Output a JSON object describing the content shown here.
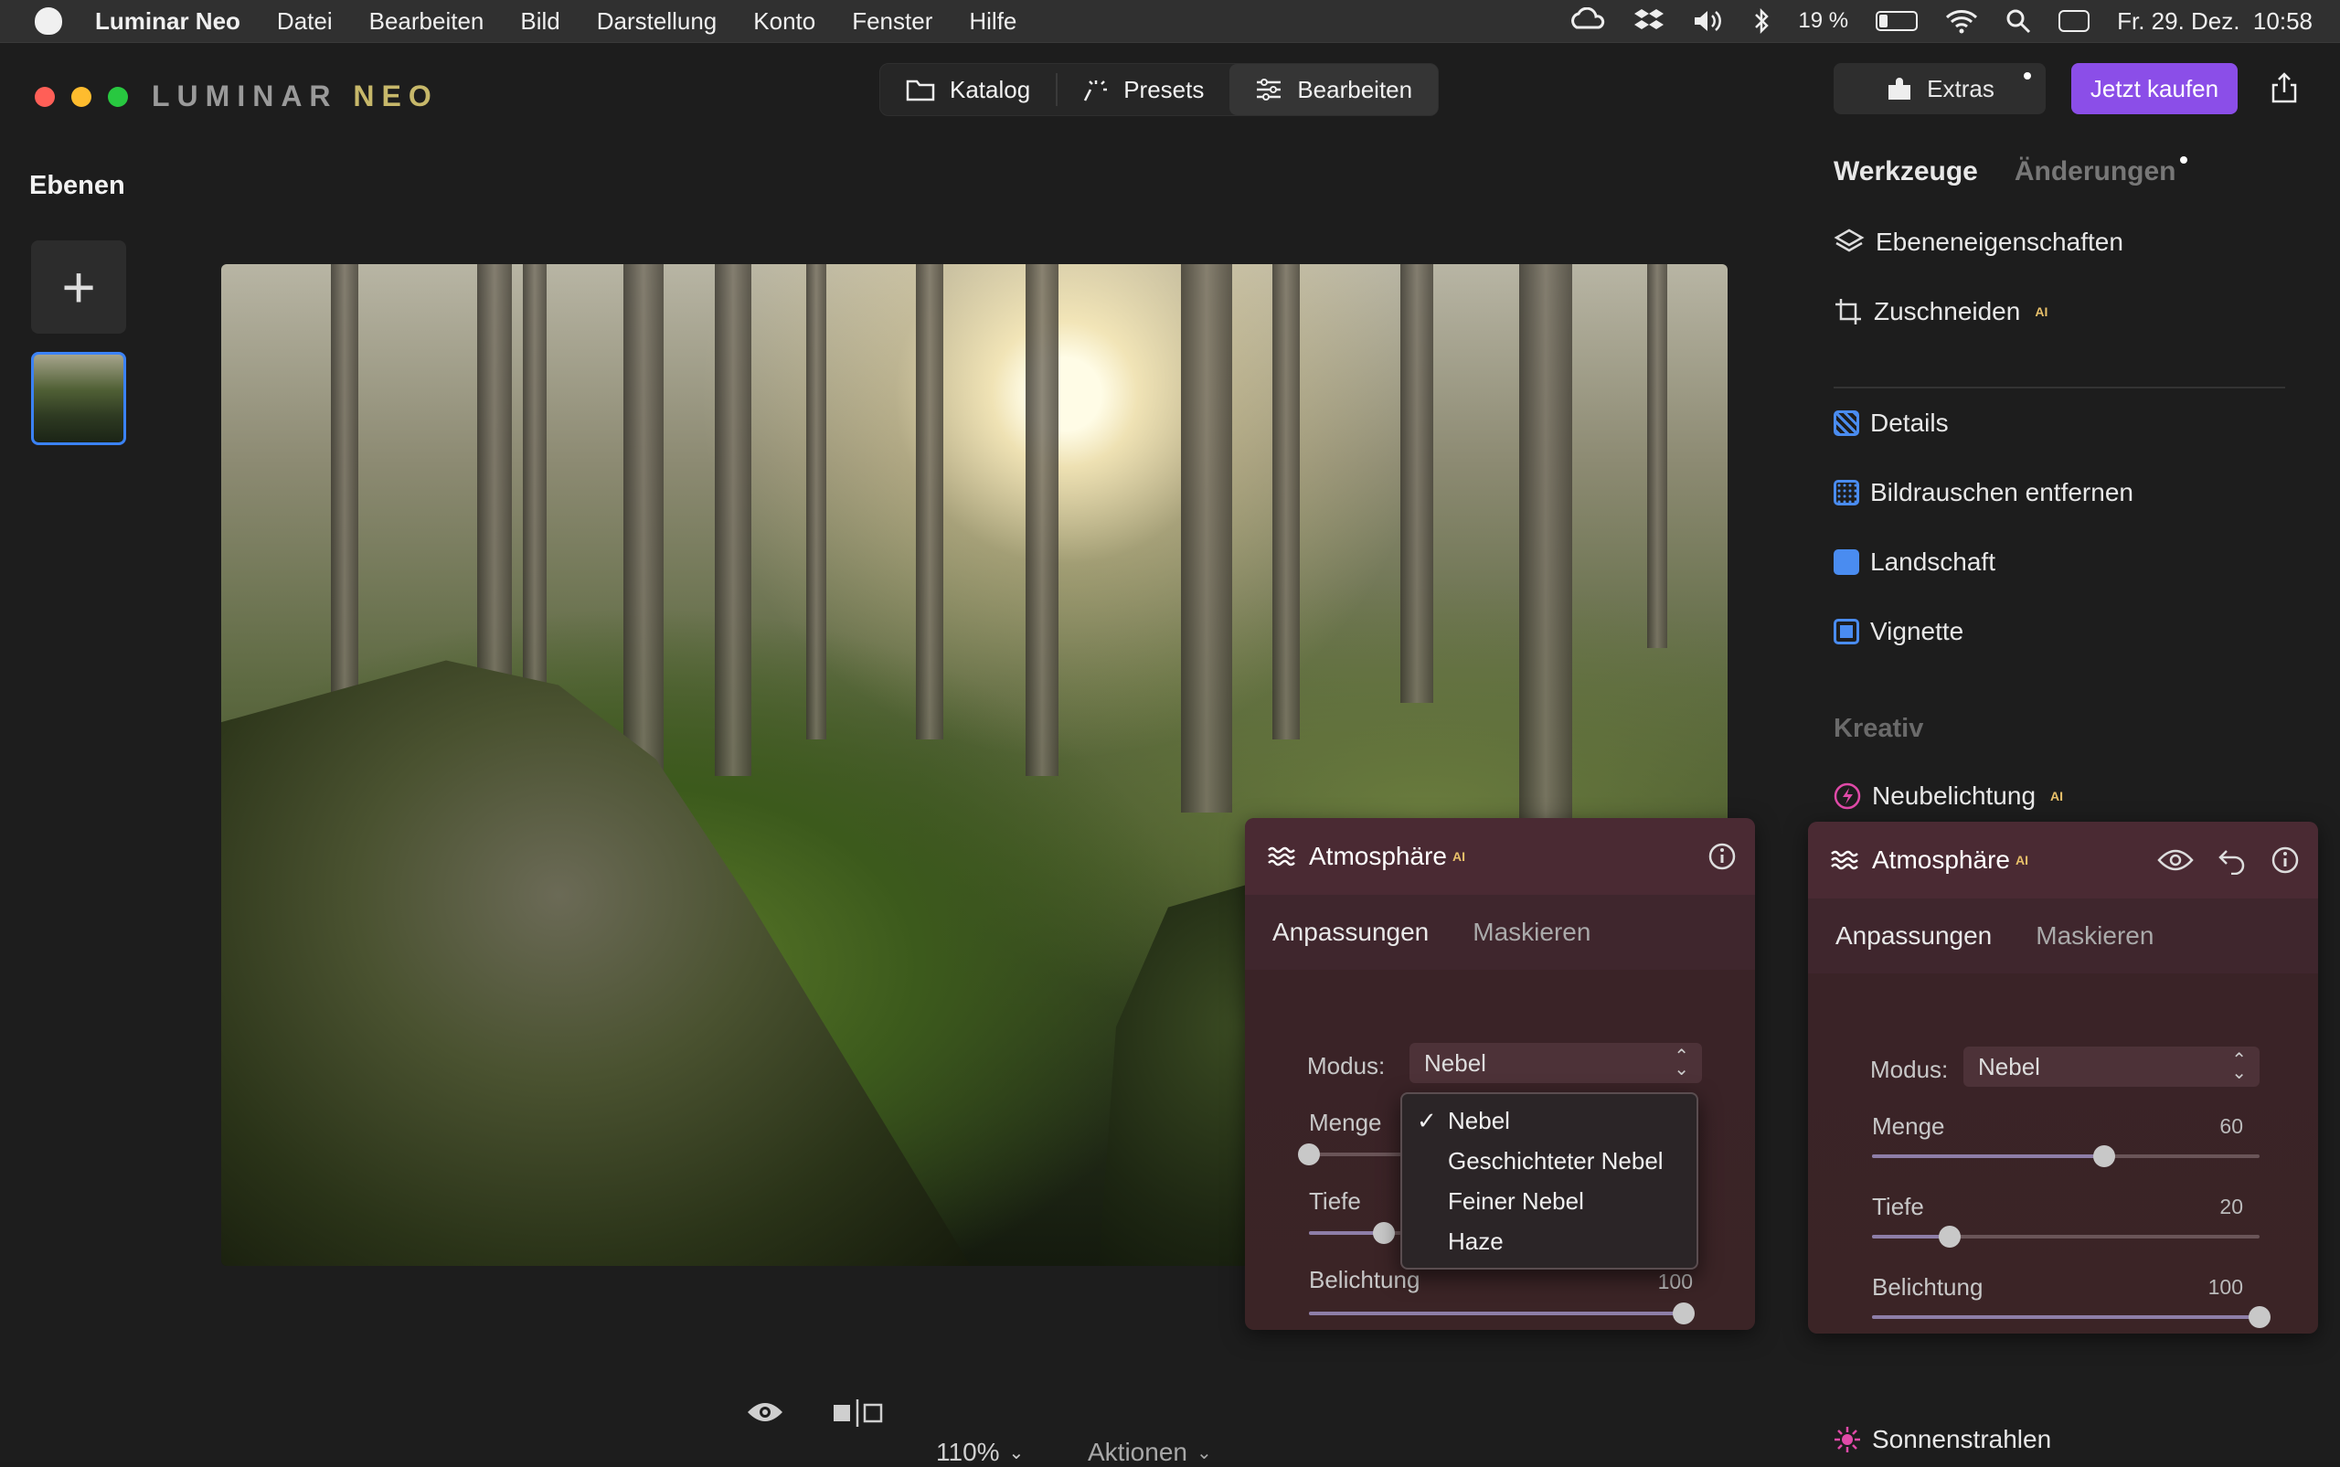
{
  "menubar": {
    "app": "Luminar Neo",
    "items": [
      "Datei",
      "Bearbeiten",
      "Bild",
      "Darstellung",
      "Konto",
      "Fenster",
      "Hilfe"
    ],
    "battery": "19 %",
    "datetime": "Fr. 29. Dez.  10:58"
  },
  "logo": {
    "part1": "LUMINAR ",
    "part2": "NEO"
  },
  "nav": {
    "katalog": "Katalog",
    "presets": "Presets",
    "bearbeiten": "Bearbeiten"
  },
  "extras": "Extras",
  "buy": "Jetzt kaufen",
  "layers": {
    "title": "Ebenen"
  },
  "tools": {
    "tab_tools": "Werkzeuge",
    "tab_changes": "Änderungen",
    "items": {
      "ebenen": "Ebeneneigenschaften",
      "zuschneiden": "Zuschneiden",
      "details": "Details",
      "rauschen": "Bildrauschen entfernen",
      "landschaft": "Landschaft",
      "vignette": "Vignette",
      "neubelichtung": "Neubelichtung",
      "sonnenstrahlen": "Sonnenstrahlen"
    },
    "kreativ": "Kreativ",
    "ai_badge": "AI"
  },
  "panel_float": {
    "title": "Atmosphäre",
    "tab1": "Anpassungen",
    "tab2": "Maskieren",
    "modus_label": "Modus:",
    "modus_value": "Nebel",
    "menge_label": "Menge",
    "tiefe_label": "Tiefe",
    "belichtung_label": "Belichtung",
    "belichtung_value": "100",
    "menge": 0,
    "tiefe": 20,
    "belichtung": 100
  },
  "dropdown": {
    "check": "✓",
    "options": [
      "Nebel",
      "Geschichteter Nebel",
      "Feiner Nebel",
      "Haze"
    ]
  },
  "panel_right": {
    "title": "Atmosphäre",
    "tab1": "Anpassungen",
    "tab2": "Maskieren",
    "modus_label": "Modus:",
    "modus_value": "Nebel",
    "menge_label": "Menge",
    "menge_value": "60",
    "tiefe_label": "Tiefe",
    "tiefe_value": "20",
    "belichtung_label": "Belichtung",
    "belichtung_value": "100",
    "menge": 60,
    "tiefe": 20,
    "belichtung": 100
  },
  "bottom": {
    "zoom": "110%",
    "aktionen": "Aktionen"
  },
  "colors": {
    "accent_buy": "#8b4ee8",
    "panel_bg": "#3a2328",
    "selection_blue": "#3b82f6"
  }
}
